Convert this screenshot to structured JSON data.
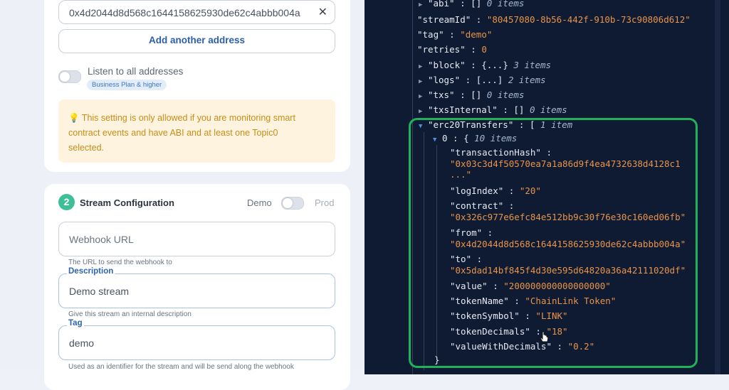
{
  "left_panel": {
    "address_input": {
      "value": "0x4d2044d8d568c1644158625930de62c4abbb004a"
    },
    "add_address_label": "Add another address",
    "listen_all": {
      "label": "Listen to all addresses",
      "badge": "Business Plan & higher"
    },
    "info": {
      "icon": "lightbulb-icon",
      "line1": "💡 This setting is only allowed if you are monitoring smart",
      "line2": "contract events and have ABI and at least one Topic0",
      "line3": "selected."
    },
    "stream_config": {
      "step": "2",
      "title": "Stream Configuration",
      "demo_label": "Demo",
      "prod_label": "Prod",
      "webhook": {
        "placeholder": "Webhook URL",
        "helper": "The URL to send the webhook to"
      },
      "description": {
        "label": "Description",
        "value": "Demo stream",
        "helper": "Give this stream an internal description"
      },
      "tag": {
        "label": "Tag",
        "value": "demo",
        "helper": "Used as an identifier for the stream and will be send along the webhook"
      }
    }
  },
  "json_viewer": {
    "colors": {
      "background": "#0e1b33",
      "string": "#e8944a",
      "key": "#e6ebf4",
      "highlight_box": "#1fb25a"
    },
    "rows": [
      {
        "key": "\"abi\"",
        "sep": " : ",
        "bracket": "[]",
        "count": "0 items"
      },
      {
        "key": "\"streamId\"",
        "sep": " : ",
        "value": "\"80457080-8b56-442f-910b-73c90806d612\""
      },
      {
        "key": "\"tag\"",
        "sep": " : ",
        "value": "\"demo\""
      },
      {
        "key": "\"retries\"",
        "sep": " : ",
        "value": "0"
      },
      {
        "key": "\"block\"",
        "sep": " : ",
        "bracket": "{...}",
        "count": "3 items"
      },
      {
        "key": "\"logs\"",
        "sep": " : ",
        "bracket": "[...]",
        "count": "2 items"
      },
      {
        "key": "\"txs\"",
        "sep": " : ",
        "bracket": "[]",
        "count": "0 items"
      },
      {
        "key": "\"txsInternal\"",
        "sep": " : ",
        "bracket": "[]",
        "count": "0 items"
      },
      {
        "key": "\"erc20Transfers\"",
        "sep": " : ",
        "bracket": "[",
        "count": "1 item"
      },
      {
        "key": "0",
        "sep": " : ",
        "bracket": "{",
        "count": "10 items"
      }
    ],
    "transfer": {
      "transactionHash_key": "\"transactionHash\"",
      "transactionHash_val1": "\"0x03c3d4f50570ea7a1a86d9f4ea4732638d4128c1",
      "transactionHash_val2": "...\"",
      "logIndex_key": "\"logIndex\"",
      "logIndex_val": "\"20\"",
      "contract_key": "\"contract\"",
      "contract_val": "\"0x326c977e6efc84e512bb9c30f76e30c160ed06fb\"",
      "from_key": "\"from\"",
      "from_val": "\"0x4d2044d8d568c1644158625930de62c4abbb004a\"",
      "to_key": "\"to\"",
      "to_val": "\"0x5dad14bf845f4d30e595d64820a36a42111020df\"",
      "value_key": "\"value\"",
      "value_val": "\"200000000000000000\"",
      "tokenName_key": "\"tokenName\"",
      "tokenName_val": "\"ChainLink Token\"",
      "tokenSymbol_key": "\"tokenSymbol\"",
      "tokenSymbol_val": "\"LINK\"",
      "tokenDecimals_key": "\"tokenDecimals\"",
      "tokenDecimals_val": "\"18\"",
      "valueWithDecimals_key": "\"valueWithDecimals\"",
      "valueWithDecimals_val": "\"0.2\"",
      "sep": " : ",
      "close": "}"
    }
  }
}
